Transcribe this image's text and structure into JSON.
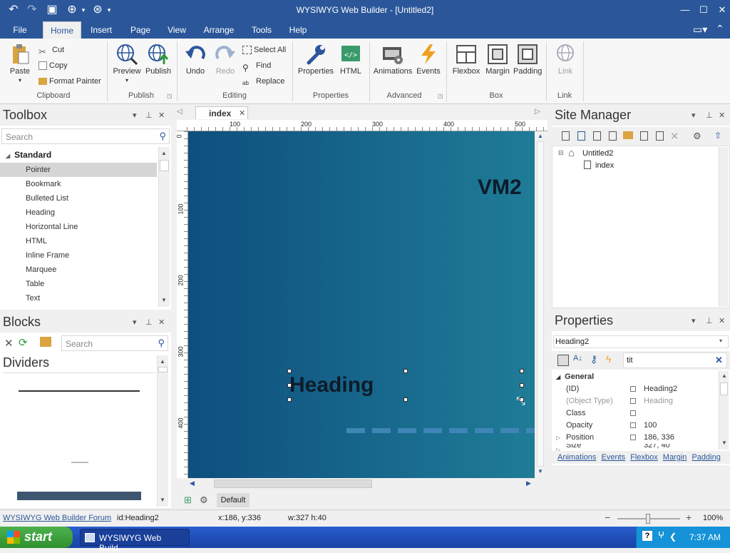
{
  "window": {
    "title": "WYSIWYG Web Builder - [Untitled2]"
  },
  "menu": {
    "tabs": [
      "File",
      "Home",
      "Insert",
      "Page",
      "View",
      "Arrange",
      "Tools",
      "Help"
    ],
    "active": "Home"
  },
  "ribbon": {
    "clipboard": {
      "paste": "Paste",
      "cut": "Cut",
      "copy": "Copy",
      "format_painter": "Format Painter",
      "label": "Clipboard"
    },
    "publish": {
      "preview": "Preview",
      "publish": "Publish",
      "label": "Publish"
    },
    "editing": {
      "undo": "Undo",
      "redo": "Redo",
      "select_all": "Select All",
      "find": "Find",
      "replace": "Replace",
      "label": "Editing"
    },
    "properties": {
      "properties": "Properties",
      "html": "HTML",
      "label": "Properties"
    },
    "advanced": {
      "animations": "Animations",
      "events": "Events",
      "label": "Advanced"
    },
    "box": {
      "flexbox": "Flexbox",
      "margin": "Margin",
      "padding": "Padding",
      "label": "Box"
    },
    "link": {
      "link": "Link",
      "label": "Link"
    }
  },
  "toolbox": {
    "title": "Toolbox",
    "search_placeholder": "Search",
    "category": "Standard",
    "items": [
      "Pointer",
      "Bookmark",
      "Bulleted List",
      "Heading",
      "Horizontal Line",
      "HTML",
      "Inline Frame",
      "Marquee",
      "Table",
      "Text"
    ]
  },
  "blocks": {
    "title": "Blocks",
    "search_placeholder": "Search",
    "category": "Dividers"
  },
  "document": {
    "tab": "index",
    "ruler_h": [
      "100",
      "200",
      "300",
      "400",
      "500"
    ],
    "ruler_v": [
      "0",
      "100",
      "200",
      "300",
      "400"
    ],
    "canvas": {
      "brand": "VM2",
      "heading": "Heading",
      "bg_start": "#0e4f7e",
      "bg_end": "#1f7c97"
    },
    "layout_button": "Default"
  },
  "site_manager": {
    "title": "Site Manager",
    "root": "Untitled2",
    "page": "index"
  },
  "properties": {
    "title": "Properties",
    "selected": "Heading2",
    "filter_value": "tit",
    "section": "General",
    "rows": [
      {
        "name": "(ID)",
        "value": "Heading2"
      },
      {
        "name": "(Object Type)",
        "value": "Heading"
      },
      {
        "name": "Class",
        "value": ""
      },
      {
        "name": "Opacity",
        "value": "100"
      },
      {
        "name": "Position",
        "value": "186, 336"
      },
      {
        "name": "Size",
        "value": "327, 40"
      }
    ],
    "links": [
      "Animations",
      "Events",
      "Flexbox",
      "Margin",
      "Padding"
    ]
  },
  "status": {
    "forum": "WYSIWYG Web Builder Forum",
    "id": "id:Heading2",
    "pos": "x:186, y:336",
    "size": "w:327 h:40",
    "zoom": "100%"
  },
  "taskbar": {
    "start": "start",
    "task": "WYSIWYG Web Build...",
    "time": "7:37 AM"
  }
}
